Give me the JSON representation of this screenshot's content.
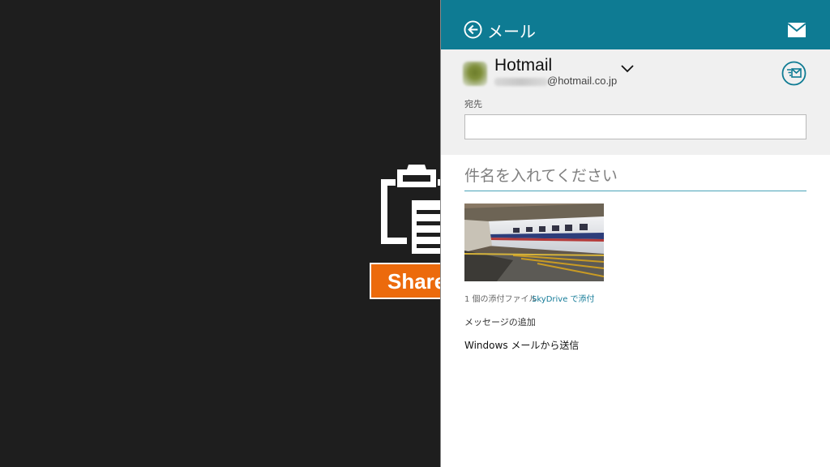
{
  "share_tile": {
    "label": "Share"
  },
  "pane": {
    "title": "メール",
    "account": {
      "name": "Hotmail",
      "email_visible": "@hotmail.co.jp"
    },
    "to": {
      "label": "宛先",
      "value": ""
    },
    "subject": {
      "placeholder": "件名を入れてください"
    },
    "attachments": {
      "count_text": "1 個の添付ファイル",
      "skydrive_link": "SkyDrive で添付"
    },
    "message_placeholder": "メッセージの追加",
    "footer": "Windows メールから送信"
  },
  "colors": {
    "pane_header": "#0e7b93",
    "account_bg": "#f0f0f0",
    "share_orange": "#ec6a0c",
    "desktop_bg": "#1e1e1e",
    "link": "#167c99"
  },
  "icons": [
    "back-arrow-icon",
    "mail-icon",
    "chevron-down-icon",
    "send-icon",
    "clipboard-icon"
  ]
}
